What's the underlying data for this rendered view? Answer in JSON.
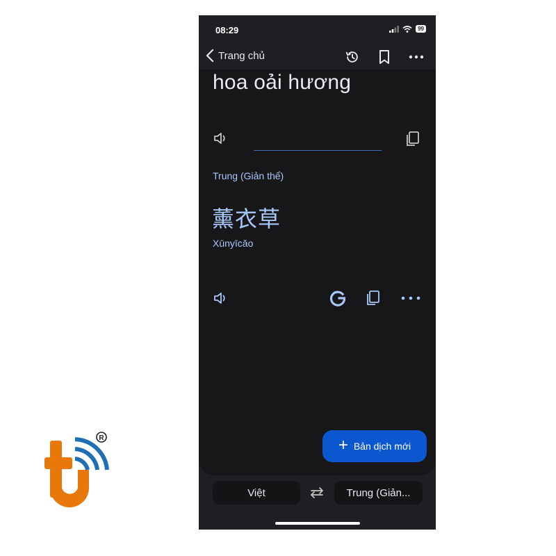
{
  "status_bar": {
    "time": "08:29",
    "battery": "99"
  },
  "top_bar": {
    "back_label": "Trang chủ"
  },
  "source": {
    "text": "hoa oải hương"
  },
  "target": {
    "language": "Trung (Giản thể)",
    "text": "薰衣草",
    "romanization": "Xūnyīcǎo"
  },
  "fab": {
    "label": "Bản dịch mới"
  },
  "language_bar": {
    "from": "Việt",
    "to": "Trung (Giản..."
  },
  "colors": {
    "accent": "#a8c7fa",
    "fab": "#0b57d0",
    "logo_orange": "#e8780a",
    "logo_blue": "#1f6fb5"
  }
}
